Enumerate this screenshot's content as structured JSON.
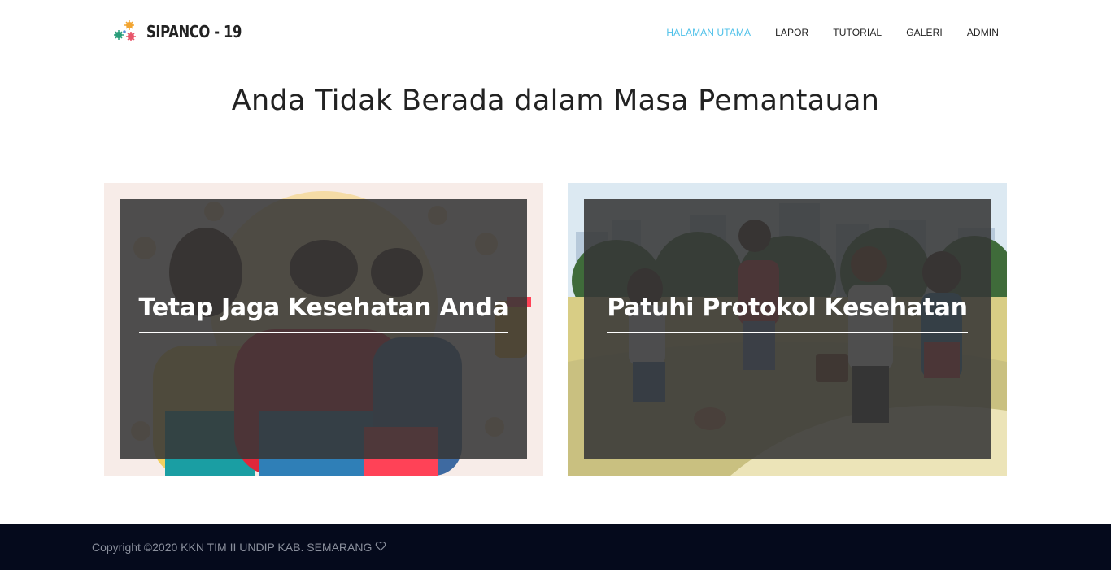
{
  "brand": {
    "name": "SIPANCO - 19",
    "logo_icon": "virus-cluster-icon"
  },
  "nav": {
    "items": [
      {
        "label": "HALAMAN UTAMA",
        "active": true
      },
      {
        "label": "LAPOR",
        "active": false
      },
      {
        "label": "TUTORIAL",
        "active": false
      },
      {
        "label": "GALERI",
        "active": false
      },
      {
        "label": "ADMIN",
        "active": false
      }
    ],
    "active_color": "#4fc1e9"
  },
  "main": {
    "title": "Anda Tidak Berada dalam Masa Pemantauan",
    "cards": [
      {
        "title": "Tetap Jaga Kesehatan Anda",
        "image": "people-with-masks-illustration"
      },
      {
        "title": "Patuhi Protokol Kesehatan",
        "image": "people-walking-in-park-illustration"
      }
    ]
  },
  "footer": {
    "copyright": "Copyright ©2020 KKN TIM II UNDIP KAB. SEMARANG",
    "icon": "heart-outline-icon",
    "background": "#050a1c"
  }
}
